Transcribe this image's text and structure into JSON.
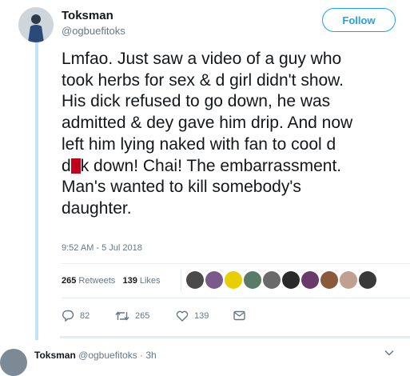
{
  "tweet": {
    "display_name": "Toksman",
    "handle": "@ogbuefitoks",
    "follow_label": "Follow",
    "lines": [
      "Lmfao. Just saw a video of a guy who",
      "took herbs for sex & d girl didn't show.",
      "His dick refused to go down, he was",
      "admitted & dey gave him drip. And now",
      "left him lying naked with fan to cool d"
    ],
    "censored_line": {
      "before": "d",
      "after": "k down! Chai! The embarrassment."
    },
    "lines_after": [
      "Man's wanted to kill somebody's",
      "daughter."
    ],
    "timestamp": "9:52 AM - 5 Jul 2018"
  },
  "stats": {
    "retweets_count": "265",
    "retweets_label": "Retweets",
    "likes_count": "139",
    "likes_label": "Likes",
    "liker_colors": [
      "#4a4a4a",
      "#7a5a8a",
      "#e8d000",
      "#5a7a6a",
      "#6a6a6a",
      "#2a2a2a",
      "#6a3a6a",
      "#8a5a3a",
      "#c0a090",
      "#3a3a3a"
    ]
  },
  "actions": {
    "reply_count": "82",
    "retweet_count": "265",
    "like_count": "139"
  },
  "reply_preview": {
    "display_name": "Toksman",
    "meta": "@ogbuefitoks · 3h"
  },
  "colors": {
    "accent": "#1da1f2",
    "thread_line": "#c3e4f5",
    "muted_text": "#657786"
  }
}
